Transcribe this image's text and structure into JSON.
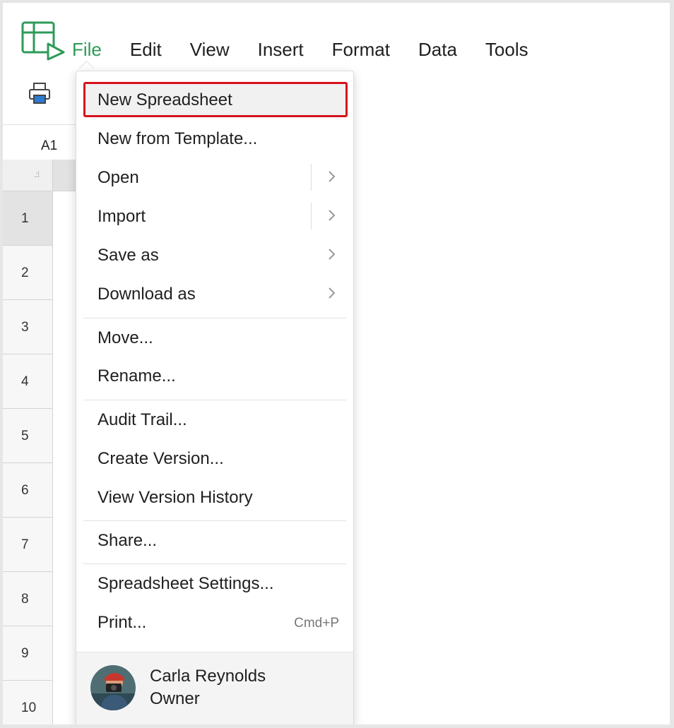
{
  "menubar": {
    "items": [
      "File",
      "Edit",
      "View",
      "Insert",
      "Format",
      "Data",
      "Tools"
    ],
    "active": "File",
    "accent_color": "#2e9a59"
  },
  "namebox": {
    "cell_ref": "A1"
  },
  "grid": {
    "rows": [
      "1",
      "2",
      "3",
      "4",
      "5",
      "6",
      "7",
      "8",
      "9",
      "10"
    ],
    "selected_row": "1"
  },
  "file_menu": {
    "highlight_color": "#d6121c",
    "items": [
      {
        "label": "New Spreadsheet"
      },
      {
        "label": "New from Template..."
      },
      {
        "label": "Open",
        "submenu_icon": "chevron-right-icon"
      },
      {
        "label": "Import",
        "submenu_icon": "chevron-right-icon"
      },
      {
        "label": "Save as",
        "submenu_icon": "chevron-right-icon"
      },
      {
        "label": "Download as",
        "submenu_icon": "chevron-right-icon"
      },
      {
        "label": "Move..."
      },
      {
        "label": "Rename..."
      },
      {
        "label": "Audit Trail..."
      },
      {
        "label": "Create Version..."
      },
      {
        "label": "View Version History"
      },
      {
        "label": "Share..."
      },
      {
        "label": "Spreadsheet Settings..."
      },
      {
        "label": "Print...",
        "shortcut": "Cmd+P"
      }
    ],
    "user": {
      "name": "Carla Reynolds",
      "role": "Owner"
    }
  },
  "icons": {
    "logo": "sheet-logo-icon",
    "print": "printer-icon",
    "corner": "select-all-icon"
  }
}
